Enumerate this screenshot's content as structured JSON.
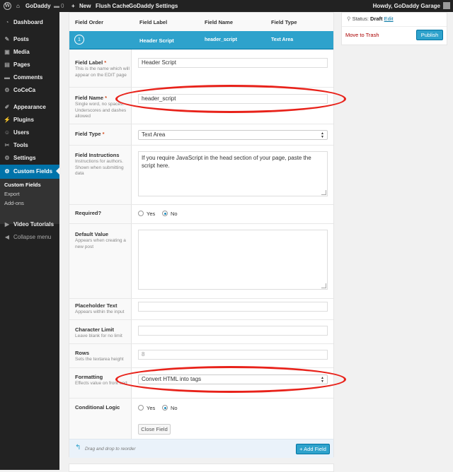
{
  "adminbar": {
    "site_name": "GoDaddy",
    "comments_count": "0",
    "new_label": "New",
    "flush_cache": "Flush Cache",
    "godaddy_settings": "GoDaddy Settings",
    "howdy": "Howdy, GoDaddy Garage"
  },
  "sidebar": {
    "items": [
      {
        "label": "Dashboard",
        "icon": "dashboard-icon",
        "glyph": "◔"
      },
      {
        "label": "Posts",
        "icon": "pin-icon",
        "glyph": "✎"
      },
      {
        "label": "Media",
        "icon": "media-icon",
        "glyph": "▣"
      },
      {
        "label": "Pages",
        "icon": "pages-icon",
        "glyph": "▤"
      },
      {
        "label": "Comments",
        "icon": "comments-icon",
        "glyph": "▬"
      },
      {
        "label": "CoCeCa",
        "icon": "plugin-icon",
        "glyph": "⚙"
      },
      {
        "label": "Appearance",
        "icon": "appearance-icon",
        "glyph": "✐"
      },
      {
        "label": "Plugins",
        "icon": "plugins-icon",
        "glyph": "⚡"
      },
      {
        "label": "Users",
        "icon": "users-icon",
        "glyph": "☺"
      },
      {
        "label": "Tools",
        "icon": "tools-icon",
        "glyph": "✂"
      },
      {
        "label": "Settings",
        "icon": "settings-icon",
        "glyph": "⚙"
      },
      {
        "label": "Custom Fields",
        "icon": "custom-fields-icon",
        "glyph": "⚙"
      }
    ],
    "submenu": [
      "Custom Fields",
      "Export",
      "Add-ons"
    ],
    "video_tutorials": "Video Tutorials",
    "collapse": "Collapse menu"
  },
  "table_header": {
    "field_order": "Field Order",
    "field_label": "Field Label",
    "field_name": "Field Name",
    "field_type": "Field Type"
  },
  "field_row": {
    "order": "1",
    "label": "Header Script",
    "name": "header_script",
    "type": "Text Area"
  },
  "form": {
    "field_label": {
      "label": "Field Label",
      "required": "*",
      "help": "This is the name which will appear on the EDIT page",
      "value": "Header Script"
    },
    "field_name": {
      "label": "Field Name",
      "required": "*",
      "help": "Single word, no spaces. Underscores and dashes allowed",
      "value": "header_script"
    },
    "field_type": {
      "label": "Field Type",
      "required": "*",
      "value": "Text Area"
    },
    "instructions": {
      "label": "Field Instructions",
      "help": "Instructions for authors. Shown when submitting data",
      "value": "If you require JavaScript in the head section of your page, paste the script here."
    },
    "required": {
      "label": "Required?",
      "yes": "Yes",
      "no": "No",
      "selected": "No"
    },
    "default_value": {
      "label": "Default Value",
      "help": "Appears when creating a new post",
      "value": ""
    },
    "placeholder": {
      "label": "Placeholder Text",
      "help": "Appears within the input",
      "value": ""
    },
    "char_limit": {
      "label": "Character Limit",
      "help": "Leave blank for no limit",
      "value": ""
    },
    "rows": {
      "label": "Rows",
      "help": "Sets the textarea height",
      "placeholder": "8"
    },
    "formatting": {
      "label": "Formatting",
      "help": "Effects value on front end",
      "value": "Convert HTML into tags"
    },
    "conditional": {
      "label": "Conditional Logic",
      "yes": "Yes",
      "no": "No",
      "selected": "No"
    },
    "close_field": "Close Field"
  },
  "footer": {
    "drag_text": "Drag and drop to reorder",
    "add_field": "+ Add Field"
  },
  "publish_box": {
    "status_label": "Status:",
    "status_value": "Draft",
    "edit": "Edit",
    "move_to_trash": "Move to Trash",
    "publish": "Publish"
  },
  "colors": {
    "accent": "#2ea2cc",
    "highlight_annotation": "#e8221a",
    "admin_dark": "#222222"
  }
}
